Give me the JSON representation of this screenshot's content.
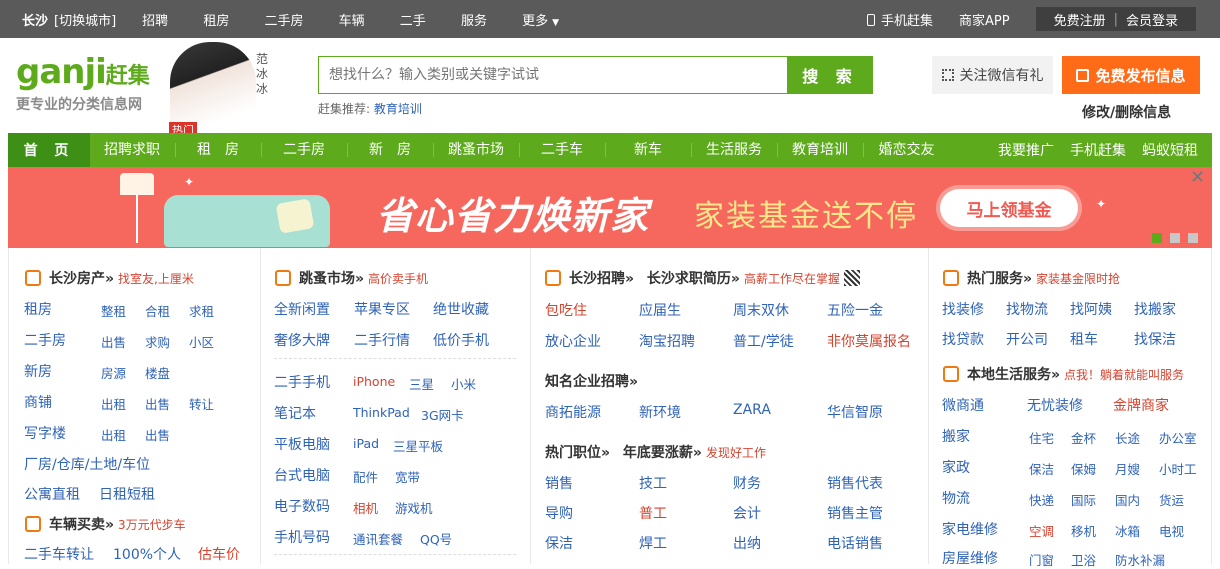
{
  "topbar": {
    "city": "长沙",
    "switch": "[切换城市]",
    "links": [
      "招聘",
      "租房",
      "二手房",
      "车辆",
      "二手",
      "服务",
      "更多"
    ],
    "mobile": "手机赶集",
    "merchant": "商家APP",
    "register": "免费注册",
    "sep": "|",
    "login": "会员登录"
  },
  "header": {
    "logo_text": "ganji",
    "logo_cn": "赶集",
    "slogan": "更专业的分类信息网",
    "celeb_name": "范冰冰",
    "hot_badge": "热门",
    "search_placeholder": "想找什么？输入类别或关键字试试",
    "search_button": "搜 索",
    "rec_label": "赶集推荐:",
    "rec_value": "教育培训",
    "wechat": "关注微信有礼",
    "post": "免费发布信息",
    "modify": "修改/删除信息"
  },
  "nav": {
    "home": "首 页",
    "items": [
      "招聘求职",
      "租　房",
      "二手房",
      "新　房",
      "跳蚤市场",
      "二手车",
      "新车",
      "生活服务",
      "教育培训",
      "婚恋交友"
    ],
    "right": [
      "我要推广",
      "手机赶集",
      "蚂蚁短租"
    ]
  },
  "banner": {
    "title": "省心省力焕新家",
    "subtitle": "家装基金送不停",
    "cta": "马上领基金",
    "close": "✕"
  },
  "realestate": {
    "title": "长沙房产",
    "tag": "找室友,上厘米",
    "rows": [
      {
        "main": "租房",
        "subs": [
          "整租",
          "合租",
          "求租"
        ]
      },
      {
        "main": "二手房",
        "subs": [
          "出售",
          "求购",
          "小区"
        ]
      },
      {
        "main": "新房",
        "subs": [
          "房源",
          "楼盘"
        ]
      },
      {
        "main": "商铺",
        "subs": [
          "出租",
          "出售",
          "转让"
        ]
      },
      {
        "main": "写字楼",
        "subs": [
          "出租",
          "出售"
        ]
      }
    ],
    "factory": "厂房/仓库/土地/车位",
    "apartment": "公寓直租",
    "daily": "日租短租"
  },
  "vehicles": {
    "title": "车辆买卖",
    "tag": "3万元代步车",
    "links": [
      "二手车转让",
      "100%个人",
      "估车价"
    ]
  },
  "market": {
    "title": "跳蚤市场",
    "tag": "高价卖手机",
    "top": [
      "全新闲置",
      "苹果专区",
      "绝世收藏",
      "奢侈大牌",
      "二手行情",
      "低价手机"
    ],
    "rows": [
      {
        "main": "二手手机",
        "subs": [
          "iPhone",
          "三星",
          "小米"
        ]
      },
      {
        "main": "笔记本",
        "subs": [
          "ThinkPad",
          "3G网卡"
        ]
      },
      {
        "main": "平板电脑",
        "subs": [
          "iPad",
          "三星平板"
        ]
      },
      {
        "main": "台式电脑",
        "subs": [
          "配件",
          "宽带"
        ]
      },
      {
        "main": "电子数码",
        "subs": [
          "相机",
          "游戏机"
        ]
      },
      {
        "main": "手机号码",
        "subs": [
          "通讯套餐",
          "QQ号"
        ]
      }
    ]
  },
  "jobs": {
    "title": "长沙招聘",
    "title2": "长沙求职简历",
    "tag": "高薪工作尽在掌握",
    "top": [
      "包吃住",
      "应届生",
      "周末双休",
      "五险一金",
      "放心企业",
      "淘宝招聘",
      "普工/学徒",
      "非你莫属报名"
    ],
    "famous_title": "知名企业招聘",
    "famous": [
      "商拓能源",
      "新环境",
      "ZARA",
      "华信智原"
    ],
    "hot_title": "热门职位",
    "hot_title2": "年底要涨薪",
    "hot_tag": "发现好工作",
    "hot": [
      "销售",
      "技工",
      "财务",
      "销售代表",
      "导购",
      "普工",
      "会计",
      "销售主管",
      "保洁",
      "焊工",
      "出纳",
      "电话销售"
    ]
  },
  "services": {
    "title": "热门服务",
    "tag": "家装基金限时抢",
    "top": [
      "找装修",
      "找物流",
      "找阿姨",
      "找搬家",
      "找贷款",
      "开公司",
      "租车",
      "找保洁"
    ],
    "local_title": "本地生活服务",
    "local_tag": "点我！躺着就能叫服务",
    "local_top": [
      "微商通",
      "无忧装修",
      "金牌商家"
    ],
    "rows": [
      {
        "main": "搬家",
        "subs": [
          "住宅",
          "金杯",
          "长途",
          "办公室"
        ]
      },
      {
        "main": "家政",
        "subs": [
          "保洁",
          "保姆",
          "月嫂",
          "小时工"
        ]
      },
      {
        "main": "物流",
        "subs": [
          "快递",
          "国际",
          "国内",
          "货运"
        ]
      },
      {
        "main": "家电维修",
        "subs": [
          "空调",
          "移机",
          "冰箱",
          "电视"
        ]
      },
      {
        "main": "房屋维修",
        "subs": [
          "门窗",
          "卫浴",
          "防水补漏"
        ]
      }
    ]
  },
  "colors": {
    "green": "#5dab1c",
    "orange": "#ff6b16",
    "link": "#2f63b7",
    "red": "#d5432f",
    "banner": "#f6685e"
  }
}
